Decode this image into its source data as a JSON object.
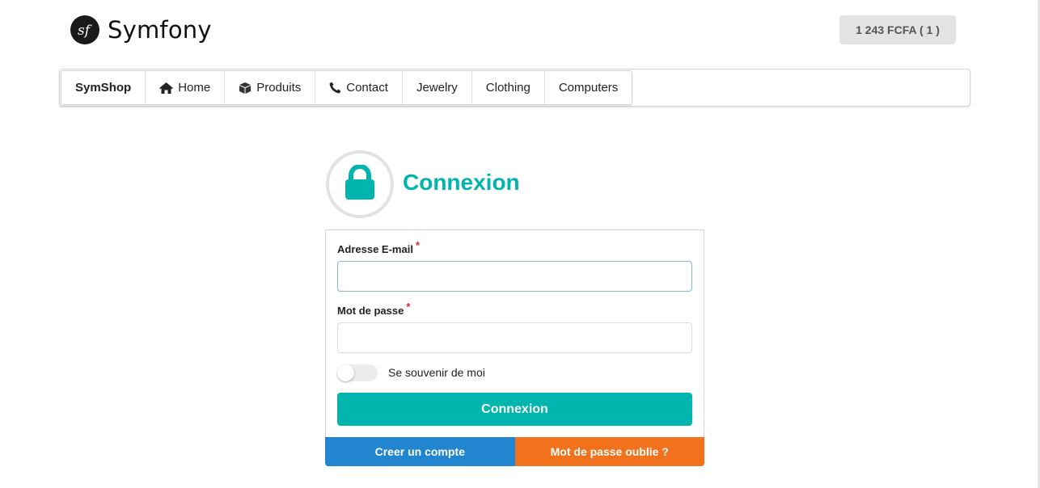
{
  "header": {
    "logo_text": "Symfony",
    "cart_label": "1 243 FCFA ( 1 )"
  },
  "nav": {
    "brand": "SymShop",
    "items": [
      {
        "label": "Home",
        "icon": "home-icon"
      },
      {
        "label": "Produits",
        "icon": "box-icon"
      },
      {
        "label": "Contact",
        "icon": "phone-icon"
      },
      {
        "label": "Jewelry"
      },
      {
        "label": "Clothing"
      },
      {
        "label": "Computers"
      }
    ]
  },
  "login": {
    "title": "Connexion",
    "email_label": "Adresse E-mail",
    "email_value": "",
    "password_label": "Mot de passe",
    "password_value": "",
    "required_mark": "*",
    "remember_label": "Se souvenir de moi",
    "remember_checked": false,
    "submit_label": "Connexion",
    "create_account_label": "Creer un compte",
    "forgot_password_label": "Mot de passe oublie ?"
  },
  "colors": {
    "accent": "#00b5ad",
    "blue": "#2185d0",
    "orange": "#f2711c",
    "required": "#db2828",
    "cart_bg": "#e2e3e5"
  }
}
